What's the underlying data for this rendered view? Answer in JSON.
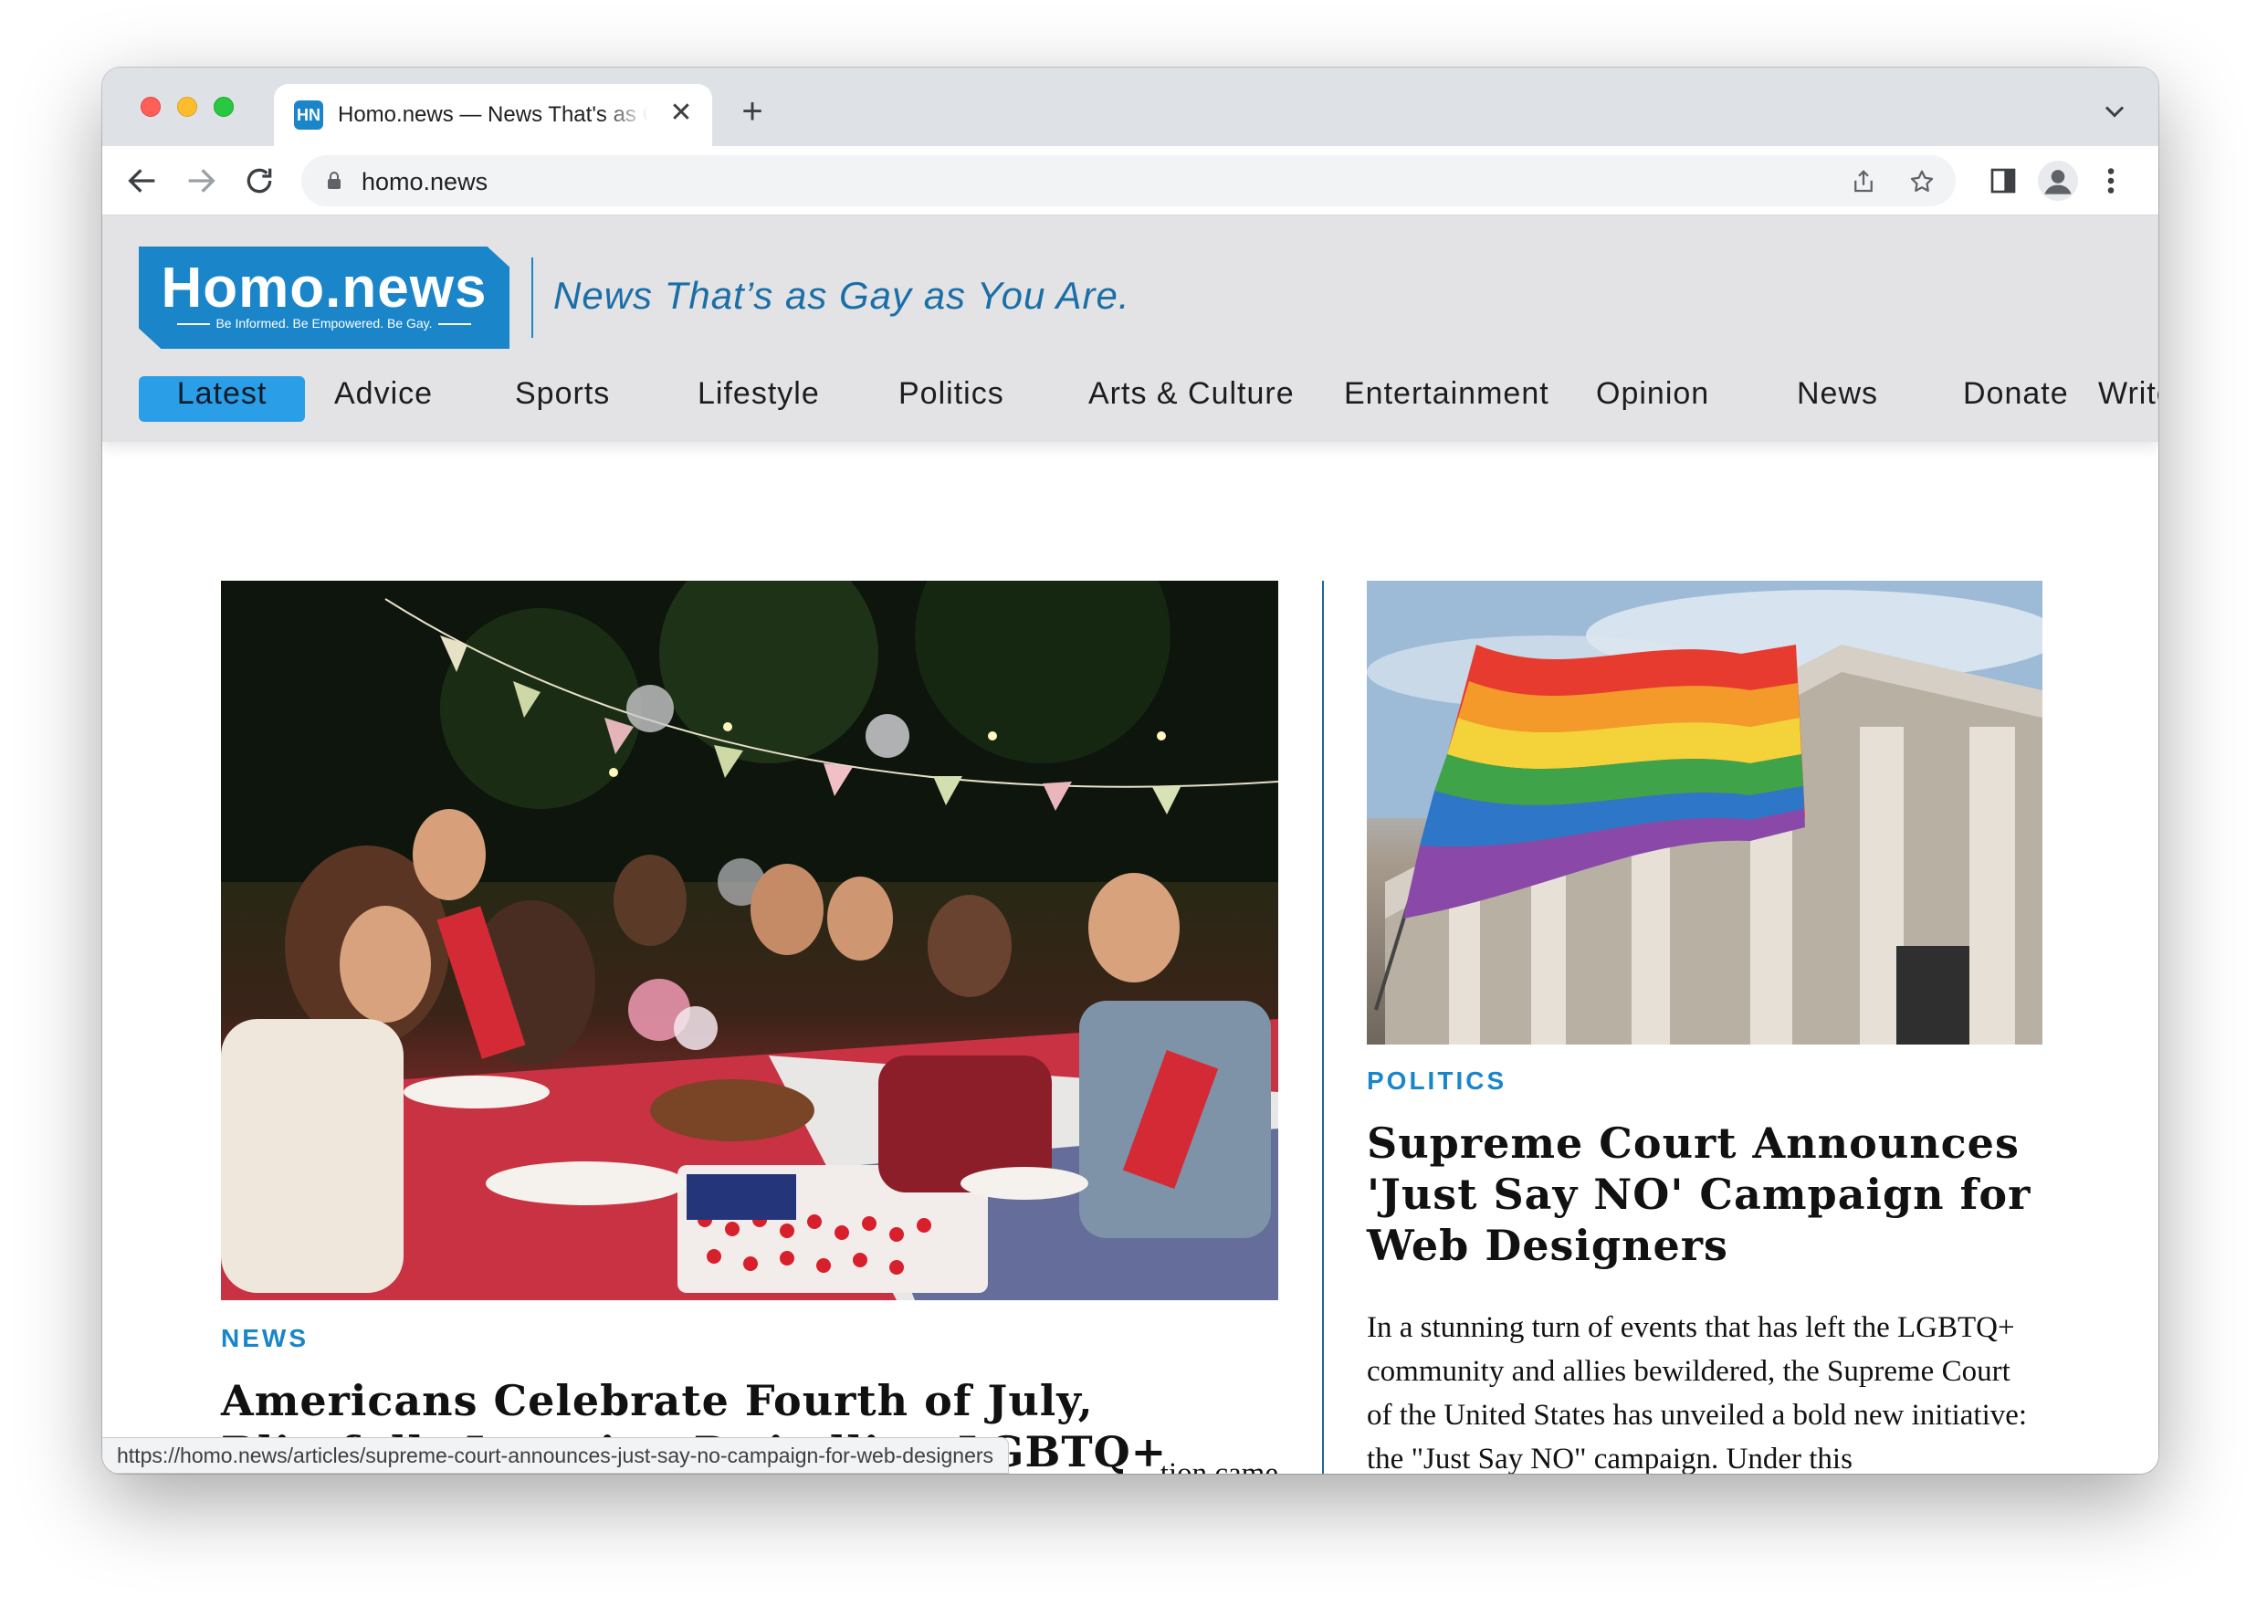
{
  "browser": {
    "tab_title": "Homo.news — News That's as Gay as You Are.",
    "favicon_text": "HN",
    "close_glyph": "✕",
    "newtab_glyph": "+",
    "url": "homo.news",
    "status_url": "https://homo.news/articles/supreme-court-announces-just-say-no-campaign-for-web-designers"
  },
  "site": {
    "logo_text": "Homo.news",
    "logo_tagline": "Be Informed. Be Empowered. Be Gay.",
    "tagline": "News That’s as Gay as You Are.",
    "nav": [
      {
        "label": "Latest"
      },
      {
        "label": "Advice"
      },
      {
        "label": "Sports"
      },
      {
        "label": "Lifestyle"
      },
      {
        "label": "Politics"
      },
      {
        "label": "Arts & Culture"
      },
      {
        "label": "Entertainment"
      },
      {
        "label": "Opinion"
      },
      {
        "label": "News"
      },
      {
        "label": "Donate"
      },
      {
        "label": "Write for Us!"
      }
    ],
    "active_nav": "Latest",
    "colors": {
      "brand": "#1a86c9",
      "active_nav_bg": "#2a9ee6",
      "header_bg": "#e3e3e5"
    }
  },
  "articles": {
    "left": {
      "category": "NEWS",
      "headline": "Americans Celebrate Fourth of July, Blissfully Ignoring Dwindling LGBTQ+ Rights",
      "excerpt_fragment": "tion came"
    },
    "right": {
      "category": "POLITICS",
      "headline": "Supreme Court Announces 'Just Say NO' Campaign for Web Designers",
      "excerpt": "In a stunning turn of events that has left the LGBTQ+ community and allies bewildered, the Supreme Court of the United States has unveiled a bold new initiative: the \"Just Say NO\" campaign. Under this groundbreaking ruling, web designers"
    }
  }
}
